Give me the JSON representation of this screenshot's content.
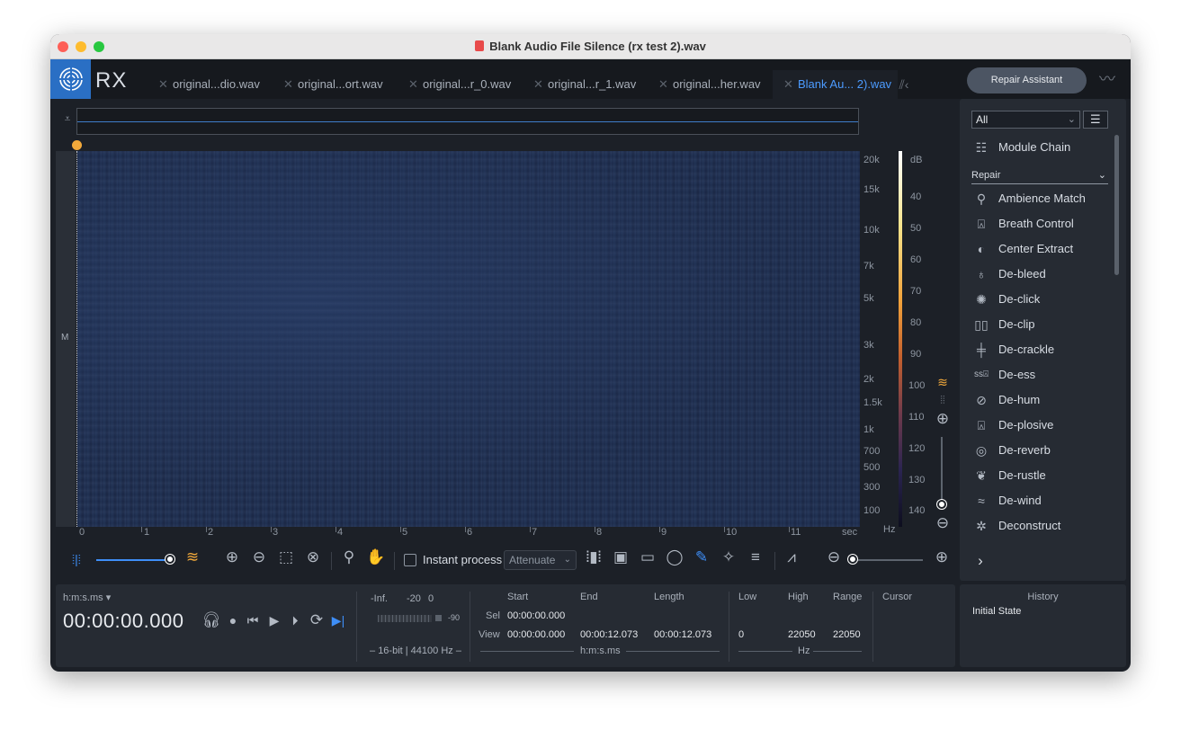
{
  "window": {
    "title": "Blank Audio File Silence (rx test 2).wav"
  },
  "app": {
    "logo_text": "RX"
  },
  "tabs": [
    {
      "label": "original...dio.wav"
    },
    {
      "label": "original...ort.wav"
    },
    {
      "label": "original...r_0.wav"
    },
    {
      "label": "original...r_1.wav"
    },
    {
      "label": "original...her.wav"
    },
    {
      "label": "Blank Au... 2).wav",
      "active": true
    }
  ],
  "repair_assistant": {
    "label": "Repair Assistant"
  },
  "channel_label": "M",
  "freq_axis": {
    "labels": [
      "20k",
      "15k",
      "10k",
      "7k",
      "5k",
      "3k",
      "2k",
      "1.5k",
      "1k",
      "700",
      "500",
      "300",
      "100",
      "Hz"
    ]
  },
  "db_axis": {
    "labels": [
      "dB",
      "40",
      "50",
      "60",
      "70",
      "80",
      "90",
      "100",
      "110",
      "120",
      "130",
      "140"
    ]
  },
  "time_axis": {
    "labels": [
      "0",
      "1",
      "2",
      "3",
      "4",
      "5",
      "6",
      "7",
      "8",
      "9",
      "10",
      "11",
      "sec"
    ]
  },
  "toolbar": {
    "instant_process_label": "Instant process",
    "attenuate_value": "Attenuate",
    "waveform_spectrogram_blend": 0.95,
    "zoom_level": 0.05
  },
  "transport": {
    "time_format": "h:m:s.ms",
    "timecode": "00:00:00.000"
  },
  "meter": {
    "labels": [
      "-Inf.",
      "-20",
      "0"
    ],
    "floor": "-90",
    "format": "16-bit | 44100 Hz"
  },
  "selection": {
    "headers": [
      "Start",
      "End",
      "Length"
    ],
    "row_labels": [
      "Sel",
      "View"
    ],
    "sel": {
      "start": "00:00:00.000",
      "end": "",
      "length": ""
    },
    "view": {
      "start": "00:00:00.000",
      "end": "00:00:12.073",
      "length": "00:00:12.073"
    },
    "unit": "h:m:s.ms"
  },
  "frequency": {
    "headers": [
      "Low",
      "High",
      "Range"
    ],
    "values": [
      "0",
      "22050",
      "22050"
    ],
    "unit": "Hz"
  },
  "cursor": {
    "label": "Cursor"
  },
  "sidebar": {
    "filter_value": "All",
    "module_chain_label": "Module Chain",
    "category_value": "Repair",
    "modules": [
      {
        "label": "Ambience Match",
        "icon": "ambience-match-icon"
      },
      {
        "label": "Breath Control",
        "icon": "breath-control-icon"
      },
      {
        "label": "Center Extract",
        "icon": "center-extract-icon"
      },
      {
        "label": "De-bleed",
        "icon": "de-bleed-icon"
      },
      {
        "label": "De-click",
        "icon": "de-click-icon"
      },
      {
        "label": "De-clip",
        "icon": "de-clip-icon"
      },
      {
        "label": "De-crackle",
        "icon": "de-crackle-icon"
      },
      {
        "label": "De-ess",
        "icon": "de-ess-icon"
      },
      {
        "label": "De-hum",
        "icon": "de-hum-icon"
      },
      {
        "label": "De-plosive",
        "icon": "de-plosive-icon"
      },
      {
        "label": "De-reverb",
        "icon": "de-reverb-icon"
      },
      {
        "label": "De-rustle",
        "icon": "de-rustle-icon"
      },
      {
        "label": "De-wind",
        "icon": "de-wind-icon"
      },
      {
        "label": "Deconstruct",
        "icon": "deconstruct-icon"
      }
    ]
  },
  "history": {
    "title": "History",
    "items": [
      "Initial State"
    ]
  },
  "colors": {
    "accent": "#3e8ef7",
    "logo_bg": "#2a6fc4",
    "playhead_marker": "#f2a93b",
    "active_tab": "#4c9bff"
  }
}
